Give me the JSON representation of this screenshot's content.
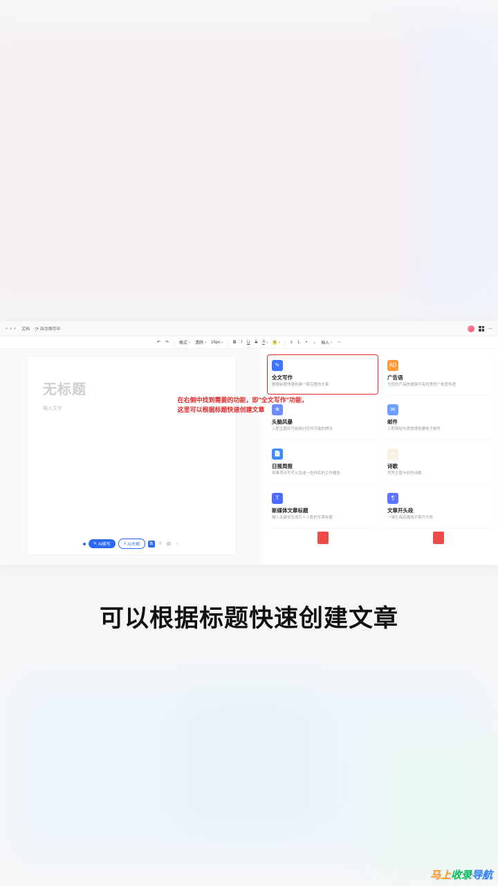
{
  "topbar": {
    "doc_label": "文档",
    "save_status": "自动保存中"
  },
  "toolbar": {
    "undo": "↶",
    "redo": "↷",
    "format_painter": "格式",
    "clear_format": "清除",
    "font_size": "16px",
    "bold": "B",
    "italic": "I",
    "underline": "U",
    "strike": "S",
    "font_color": "A",
    "highlight": "A",
    "align_left": "≡",
    "list_ordered": "1.",
    "list_unordered": "•",
    "indent": "→",
    "insert": "插入",
    "more": "⋯"
  },
  "doc": {
    "title_placeholder": "无标题",
    "body_placeholder": "输入文字"
  },
  "overlay": {
    "line1": "在右侧中找到需要的功能，即\"全文写作\"功能，",
    "line2": "这里可以根据标题快速创建文章"
  },
  "footer": {
    "ai_continue": "AI续写",
    "ai_outline": "AI大纲",
    "count_label": "数",
    "mode_a": "≡",
    "mode_b": "田",
    "next": "›"
  },
  "features": [
    {
      "title": "全文写作",
      "desc": "根据标题快速创建一篇完整的文章",
      "icon_bg": "#3b74ff",
      "icon": "✎",
      "highlight": true
    },
    {
      "title": "广告语",
      "desc": "为您的产品快速撰写有创意的广告宣传语",
      "icon_bg": "#ff9a3b",
      "icon": "AD",
      "highlight": false
    },
    {
      "title": "头脑风暴",
      "desc": "入职主题并开始探讨任何可能的想法",
      "icon_bg": "#6f8cff",
      "icon": "❄",
      "highlight": false
    },
    {
      "title": "邮件",
      "desc": "入职简短句意快速创建电子邮件",
      "icon_bg": "#6fa0ff",
      "icon": "✉",
      "highlight": false
    },
    {
      "title": "日报周报",
      "desc": "将事项点写可以生成一份详实的工作报告",
      "icon_bg": "#3b8bff",
      "icon": "📄",
      "highlight": false
    },
    {
      "title": "诗歌",
      "desc": "凭凭主题卡创作诗歌",
      "icon_bg": "#f6f1e0",
      "icon": "✒",
      "highlight": false
    },
    {
      "title": "新媒体文章标题",
      "desc": "输入关键词生成引人入胜的文章标题",
      "icon_bg": "#4d6bff",
      "icon": "T",
      "highlight": false
    },
    {
      "title": "文章开头段",
      "desc": "一键生成高播放文章开头段",
      "icon_bg": "#5d74ff",
      "icon": "¶",
      "highlight": false
    }
  ],
  "partial_icons": {
    "left_bg": "#ee4b4b",
    "right_bg": "#ee4b4b"
  },
  "caption": "可以根据标题快速创建文章",
  "watermark": {
    "part1": "马上",
    "part2": "收录",
    "part3": "导航"
  }
}
